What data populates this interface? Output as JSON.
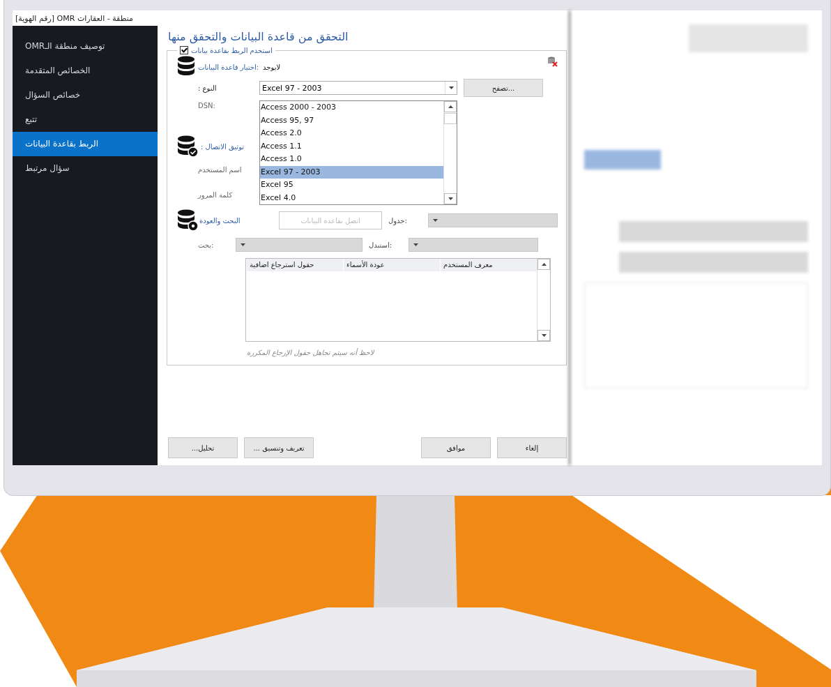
{
  "window": {
    "title": "منطقة - العقارات OMR [رقم الهوية]"
  },
  "sidebar": {
    "items": [
      {
        "label": "توصيف منطقة الـOMR",
        "selected": false
      },
      {
        "label": "الخصائص المتقدمة",
        "selected": false
      },
      {
        "label": "خصائص السؤال",
        "selected": false
      },
      {
        "label": "تتبع",
        "selected": false
      },
      {
        "label": "الربط بقاعدة البيانات",
        "selected": true
      },
      {
        "label": "سؤال مرتبط",
        "selected": false
      }
    ]
  },
  "main": {
    "heading": "التحقق من قاعدة البيانات والتحقق منها",
    "use_database": {
      "label": "استخدم الربط بقاعدة بيانات",
      "checked": true
    },
    "database_choice": {
      "label": "اختيار قاعدة البيانات:",
      "value": "لايوجد"
    },
    "type": {
      "label": ": النوع",
      "value": "Excel 97 - 2003",
      "expanded": true,
      "options": [
        {
          "label": "Access 2000 - 2003",
          "selected": false
        },
        {
          "label": "Access 95, 97",
          "selected": false
        },
        {
          "label": "Access 2.0",
          "selected": false
        },
        {
          "label": "Access 1.1",
          "selected": false
        },
        {
          "label": "Access 1.0",
          "selected": false
        },
        {
          "label": "Excel 97 - 2003",
          "selected": true
        },
        {
          "label": "Excel 95",
          "selected": false
        },
        {
          "label": "Excel 4.0",
          "selected": false
        }
      ]
    },
    "browse_button": "تصفح...",
    "dsn_label": "DSN:",
    "connection": {
      "label": ": توثيق الاتصال",
      "username_label": "اسم المستخدم",
      "password_label": "كلمة المرور"
    },
    "search": {
      "label": "البحث والعودة",
      "connect_button": {
        "label": "اتصل بقاعدة البيانات",
        "disabled": true
      },
      "table": {
        "label": "جدول:",
        "disabled": true
      },
      "search_field": {
        "label": "بحث:",
        "disabled": true
      },
      "replace": {
        "label": "استبدل:",
        "disabled": true
      }
    },
    "grid": {
      "columns": [
        "معرف المستخدم",
        "عودة الأسماء",
        "حقول استرجاع اضافية"
      ]
    },
    "note": "لاحظ أنه سيتم تجاهل حقول الإرجاع المكررة",
    "footer": {
      "right_buttons": [
        "إلغاء",
        "موافق"
      ],
      "left_buttons": [
        "... تعريف وتنسيق",
        "...تحليل"
      ]
    }
  }
}
